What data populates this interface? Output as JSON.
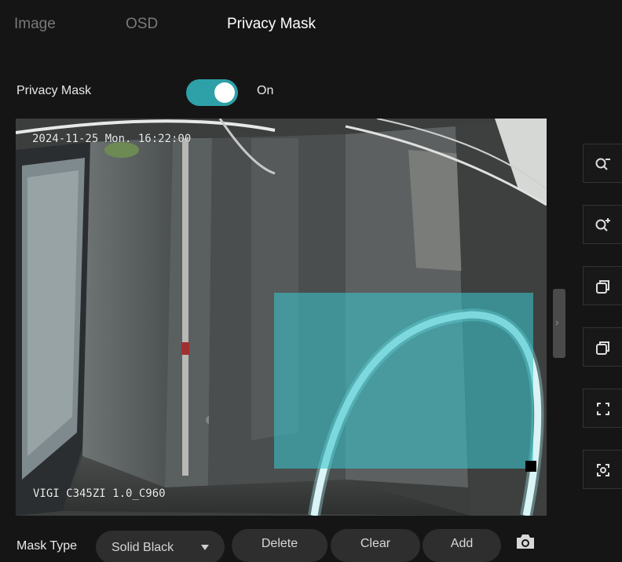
{
  "tabs": [
    {
      "label": "Image",
      "active": false
    },
    {
      "label": "OSD",
      "active": false
    },
    {
      "label": "Privacy Mask",
      "active": true
    }
  ],
  "privacy_mask": {
    "label": "Privacy Mask",
    "enabled": true,
    "state_text": "On"
  },
  "video": {
    "osd_datetime": "2024-11-25 Mon. 16:22:00",
    "osd_model": "VIGI C345ZI 1.0_C960",
    "mask_color": "#38c4cc"
  },
  "side_toolbar": [
    {
      "icon": "zoom-out-icon"
    },
    {
      "icon": "zoom-in-icon"
    },
    {
      "icon": "window-icon"
    },
    {
      "icon": "window-restore-icon"
    },
    {
      "icon": "fullscreen-icon"
    },
    {
      "icon": "focus-icon"
    }
  ],
  "controls": {
    "mask_type_label": "Mask Type",
    "mask_type_value": "Solid Black",
    "delete_label": "Delete",
    "clear_label": "Clear",
    "add_label": "Add",
    "snapshot_icon": "camera-icon"
  },
  "colors": {
    "accent": "#2ea0a8",
    "background": "#151515",
    "button_bg": "#2e2e2e"
  }
}
